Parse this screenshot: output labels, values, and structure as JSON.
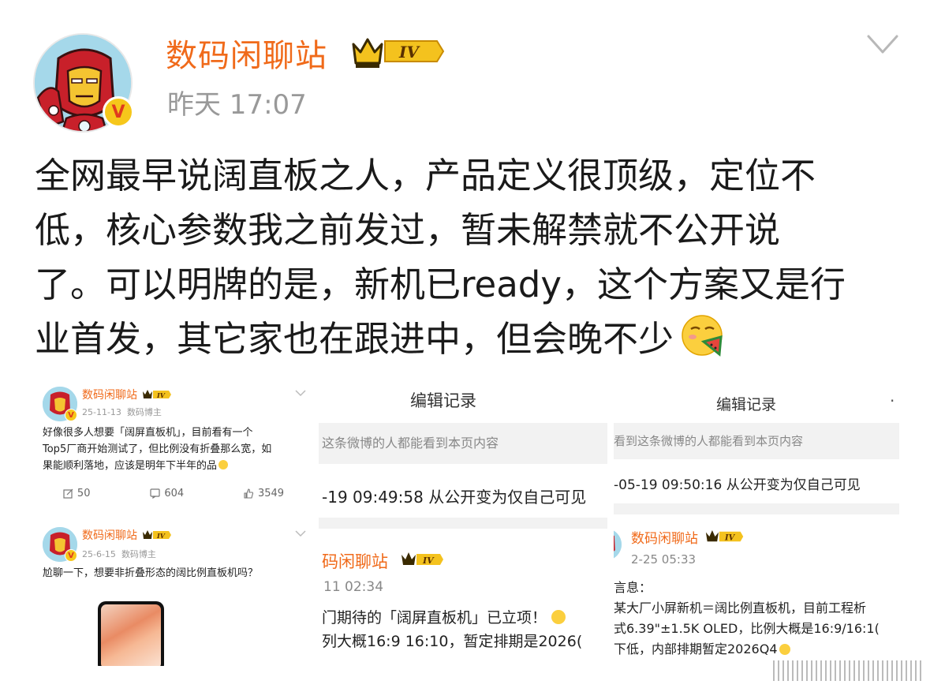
{
  "header": {
    "author": "数码闲聊站",
    "level_badge": "IV",
    "verified_mark": "V",
    "time": "昨天 17:07"
  },
  "post": {
    "lines": [
      "全网最早说阔直板之人，产品定义很顶级，定位不",
      "低，核心参数我之前发过，暂未解禁就不公开说",
      "了。可以明牌的是，新机已ready，这个方案又是行",
      "业首发，其它家也在跟进中，但会晚不少"
    ],
    "emoji": "smug-eating-watermelon-emoji"
  },
  "panel1": {
    "author": "数码闲聊站",
    "level_badge": "IV",
    "date": "25-11-13",
    "source": "数码博主",
    "text": [
      "好像很多人想要「阔屏直板机」，目前看有一个",
      "Top5厂商开始测试了，但比例没有折叠那么宽，如",
      "果能顺利落地，应该是明年下半年的品"
    ],
    "reposts": "50",
    "comments": "604",
    "likes": "3549"
  },
  "panel2": {
    "author": "数码闲聊站",
    "level_badge": "IV",
    "date": "25-6-15",
    "source": "数码博主",
    "text": "尬聊一下，想要非折叠形态的阔比例直板机吗？"
  },
  "panel3": {
    "title": "编辑记录",
    "notice": "这条微博的人都能看到本页内容",
    "log": "-19 09:49:58 从公开变为仅自己可见",
    "author": "码闲聊站",
    "level_badge": "IV",
    "time": "11 02:34",
    "text": [
      "门期待的「阔屏直板机」已立项！",
      "列大概16:9 16:10，暂定排期是2026("
    ]
  },
  "panel4": {
    "title": "编辑记录",
    "dot": "·",
    "notice": "看到这条微博的人都能看到本页内容",
    "log": "-05-19 09:50:16 从公开变为仅自己可见",
    "author": "数码闲聊站",
    "level_badge": "IV",
    "time": "2-25 05:33",
    "text": [
      "言息：",
      "某大厂小屏新机＝阔比例直板机，目前工程析",
      "式6.39\"±1.5K OLED，比例大概是16:9/16:1(",
      "下低，内部排期暂定2026Q4"
    ]
  }
}
